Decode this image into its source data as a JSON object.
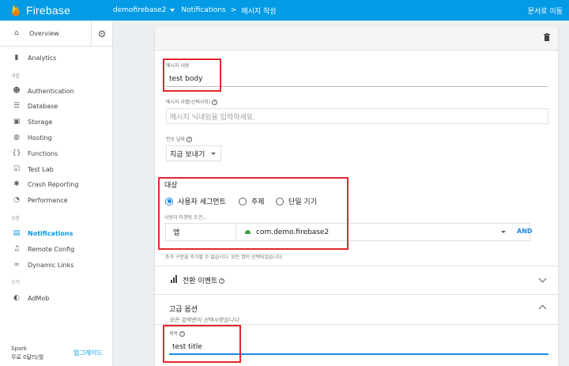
{
  "topbar": {
    "brand": "Firebase",
    "project": "demofirebase2",
    "crumb_section": "Notifications",
    "crumb_separator": ">",
    "crumb_page": "메시지 작성",
    "docs_link": "문서로 이동",
    "color": "#039be5"
  },
  "sidebar": {
    "overview": "Overview",
    "items": [
      {
        "label": "Analytics",
        "icon": "bar-chart-icon"
      },
      {
        "label": "Authentication",
        "icon": "people-icon"
      },
      {
        "label": "Database",
        "icon": "database-icon"
      },
      {
        "label": "Storage",
        "icon": "image-icon"
      },
      {
        "label": "Hosting",
        "icon": "globe-icon"
      },
      {
        "label": "Functions",
        "icon": "functions-icon"
      },
      {
        "label": "Test Lab",
        "icon": "clipboard-icon"
      },
      {
        "label": "Crash Reporting",
        "icon": "bug-icon"
      },
      {
        "label": "Performance",
        "icon": "speedometer-icon"
      },
      {
        "label": "Notifications",
        "icon": "message-icon"
      },
      {
        "label": "Remote Config",
        "icon": "remote-config-icon"
      },
      {
        "label": "Dynamic Links",
        "icon": "link-icon"
      },
      {
        "label": "AdMob",
        "icon": "admob-icon"
      }
    ],
    "sections": {
      "develop": "개발",
      "grow": "성장",
      "earn": "수익"
    },
    "plan_name": "Spark",
    "plan_price": "무료 0달러/월",
    "upgrade": "업그레이드"
  },
  "form": {
    "message_text_label": "메시지 내용",
    "message_text_value": "test body",
    "message_label_label": "메시지 라벨(선택사항)",
    "message_label_placeholder": "메시지 닉네임을 입력하세요.",
    "delivery_date_label": "전송 날짜",
    "delivery_date_value": "지금 보내기",
    "target_title": "대상",
    "target_options": [
      "사용자 세그먼트",
      "주제",
      "단일 기기"
    ],
    "targeting_conditions_label": "사용자 타겟팅 조건...",
    "condition_type": "앱",
    "condition_app": "com.demo.firebase2",
    "and_button": "AND",
    "condition_note": "추가 구문을 추가할 수 없습니다. 모든 앱이 선택되었습니다.",
    "conversion_events": "전환 이벤트",
    "advanced_title": "고급 옵션",
    "advanced_subtitle": "모든 입력란이 선택사항입니다.",
    "title_label": "제목",
    "title_value": "test title"
  }
}
